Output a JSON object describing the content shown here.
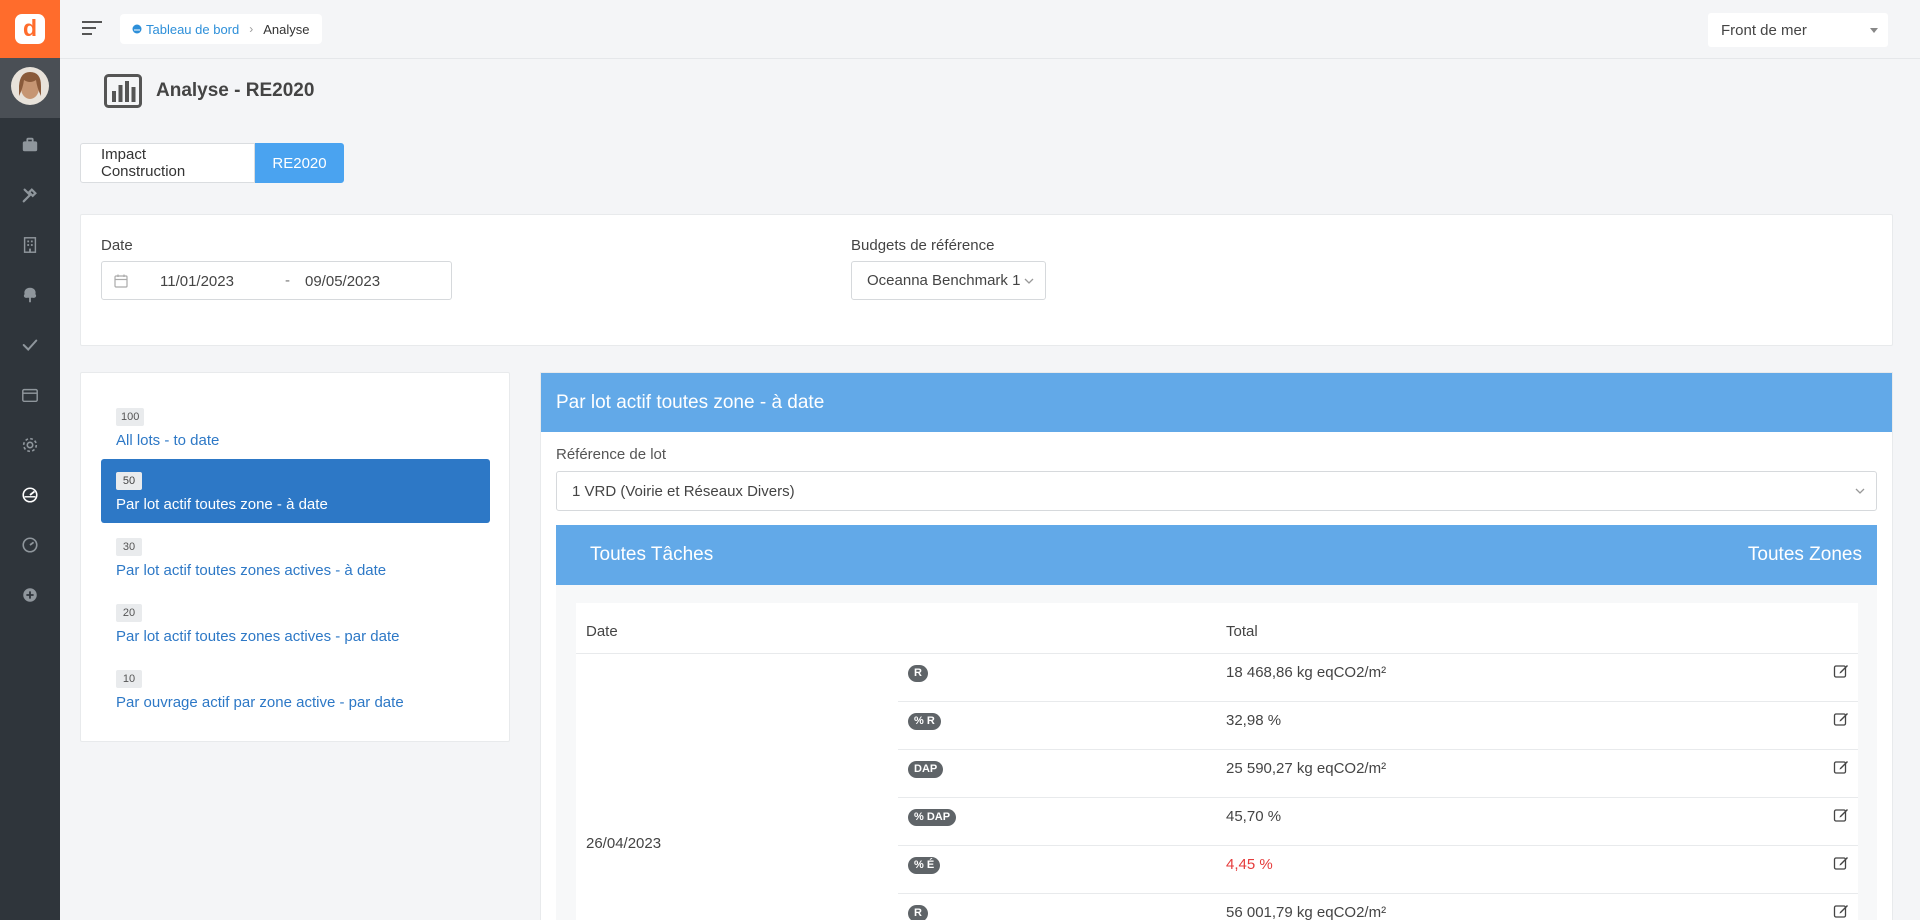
{
  "topbar": {
    "breadcrumb_home": "Tableau de bord",
    "breadcrumb_current": "Analyse",
    "site_selected": "Front de mer"
  },
  "page": {
    "title": "Analyse - RE2020"
  },
  "tabs": [
    {
      "label": "Impact Construction",
      "active": false
    },
    {
      "label": "RE2020",
      "active": true
    }
  ],
  "filters": {
    "date_label": "Date",
    "date_start": "11/01/2023",
    "date_separator": "-",
    "date_end": "09/05/2023",
    "budget_label": "Budgets de référence",
    "budget_selected": "Oceanna Benchmark 1"
  },
  "analyses": [
    {
      "badge": "100",
      "label": "All lots - to date",
      "active": false
    },
    {
      "badge": "50",
      "label": "Par lot actif toutes zone - à date",
      "active": true
    },
    {
      "badge": "30",
      "label": "Par lot actif toutes zones actives - à date",
      "active": false
    },
    {
      "badge": "20",
      "label": "Par lot actif toutes zones actives - par date",
      "active": false
    },
    {
      "badge": "10",
      "label": "Par ouvrage actif par zone active - par date",
      "active": false
    }
  ],
  "panel": {
    "title": "Par lot actif toutes zone - à date",
    "lot_ref_label": "Référence de lot",
    "lot_selected": "1 VRD (Voirie et Réseaux Divers)",
    "tasks_label": "Toutes Tâches",
    "zones_label": "Toutes Zones",
    "table": {
      "col_date": "Date",
      "col_total": "Total",
      "date_value": "26/04/2023",
      "rows": [
        {
          "tag": "R",
          "value": "18 468,86 kg eqCO2/m²",
          "highlight": false
        },
        {
          "tag": "% R",
          "value": "32,98 %",
          "highlight": false
        },
        {
          "tag": "DAP",
          "value": "25 590,27 kg eqCO2/m²",
          "highlight": false
        },
        {
          "tag": "% DAP",
          "value": "45,70 %",
          "highlight": false
        },
        {
          "tag": "% É",
          "value": "4,45 %",
          "highlight": true
        },
        {
          "tag": "R",
          "value": "56 001,79 kg eqCO2/m²",
          "highlight": false
        }
      ]
    }
  },
  "colors": {
    "accent": "#4aa3f0",
    "header_blue": "#62a9e8",
    "list_active": "#2d78c6",
    "sidebar": "#2f353b",
    "logo": "#ff6c2c",
    "alert": "#e53c3c"
  }
}
